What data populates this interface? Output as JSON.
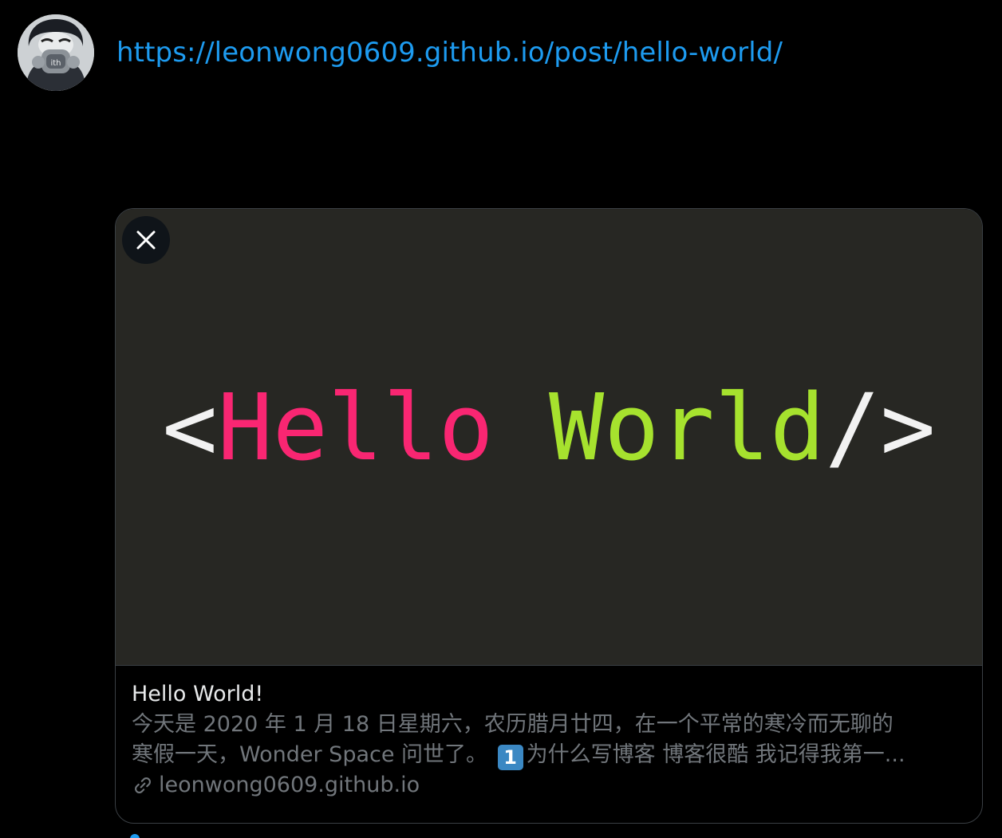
{
  "composer": {
    "text": "https://leonwong0609.github.io/post/hello-world/",
    "avatar_icon": "avatar-image",
    "link_color": "#1d9bf0"
  },
  "card": {
    "image": {
      "lt": "<",
      "word1": "Hello",
      "space": " ",
      "word2": "World",
      "slash": "/",
      "gt": ">",
      "colors": {
        "background": "#272723",
        "brackets": "#f2f2f2",
        "hello": "#f92672",
        "world": "#a6e22e"
      }
    },
    "close_icon": "close-icon",
    "title": "Hello World!",
    "description_line1": "今天是 2020 年 1 月 18 日星期六，农历腊月廿四，在一个平常的寒冷而无聊的",
    "description_line2_a": "寒假一天，Wonder Space 问世了。",
    "keycap": "1",
    "description_line2_b": "为什么写博客 博客很酷 我记得我第一...",
    "link_icon": "link-icon",
    "domain": "leonwong0609.github.io"
  }
}
